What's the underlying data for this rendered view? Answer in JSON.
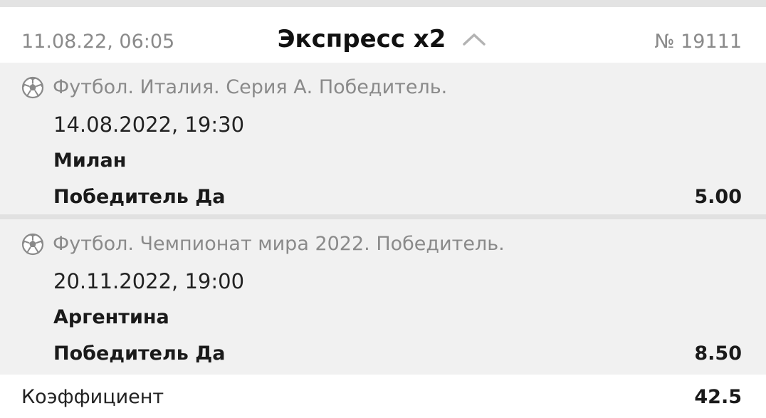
{
  "header": {
    "date": "11.08.22, 06:05",
    "title": "Экспресс x2",
    "toggle_icon": "chevron-up-icon",
    "number": "№ 19111"
  },
  "bets": [
    {
      "sport_icon": "soccer-ball-icon",
      "sport_line": "Футбол. Италия. Серия А. Победитель.",
      "event_date": "14.08.2022, 19:30",
      "team": "Милан",
      "market": "Победитель Да",
      "odds": "5.00"
    },
    {
      "sport_icon": "soccer-ball-icon",
      "sport_line": "Футбол. Чемпионат мира 2022. Победитель.",
      "event_date": "20.11.2022, 19:00",
      "team": "Аргентина",
      "market": "Победитель Да",
      "odds": "8.50"
    }
  ],
  "footer": {
    "coef_label": "Коэффициент",
    "coef_value": "42.5"
  },
  "colors": {
    "bet_background": "#f1f1f1",
    "muted_text": "#8a8a8a",
    "separator": "#e1e1e1"
  }
}
